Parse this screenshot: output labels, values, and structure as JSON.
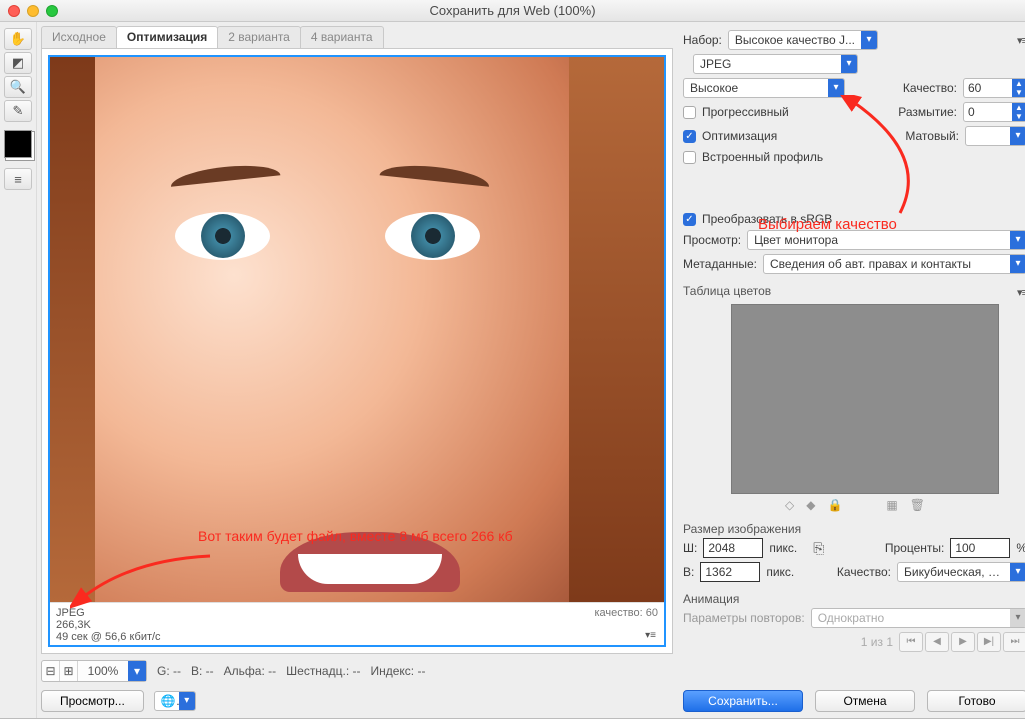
{
  "titlebar": {
    "title": "Сохранить для Web (100%)"
  },
  "tabs": {
    "source": "Исходное",
    "optimize": "Оптимизация",
    "two": "2 варианта",
    "four": "4 варианта"
  },
  "info": {
    "format": "JPEG",
    "size": "266,3K",
    "time": "49 сек @ 56,6 кбит/с",
    "quality_label": "качество: 60"
  },
  "annotation1": "Вот таким будет файл, вместе 8 мб всего 266 кб",
  "annotation2": "Выбираем качество",
  "under": {
    "zoom": "100%",
    "G": "G: --",
    "B": "B: --",
    "alpha": "Альфа: --",
    "hex": "Шестнадц.: --",
    "index": "Индекс: --",
    "preview_btn": "Просмотр..."
  },
  "right": {
    "preset_lbl": "Набор:",
    "preset_val": "Высокое качество J...",
    "format": "JPEG",
    "quality_preset": "Высокое",
    "qual_lbl": "Качество:",
    "qual_val": "60",
    "blur_lbl": "Размытие:",
    "blur_val": "0",
    "matte_lbl": "Матовый:",
    "chk_progressive": "Прогрессивный",
    "chk_optimize": "Оптимизация",
    "chk_profile": "Встроенный профиль",
    "chk_srgb": "Преобразовать в sRGB",
    "viewer_lbl": "Просмотр:",
    "viewer_val": "Цвет монитора",
    "meta_lbl": "Метаданные:",
    "meta_val": "Сведения об авт. правах и контакты",
    "ct_title": "Таблица цветов",
    "size_title": "Размер изображения",
    "w_lbl": "Ш:",
    "w_val": "2048",
    "h_lbl": "В:",
    "h_val": "1362",
    "px": "пикс.",
    "pct_lbl": "Проценты:",
    "pct_val": "100",
    "pct_sign": "%",
    "resample_lbl": "Качество:",
    "resample_val": "Бикубическая, ч...",
    "anim_title": "Анимация",
    "loop_lbl": "Параметры повторов:",
    "loop_val": "Однократно",
    "frame": "1 из 1"
  },
  "buttons": {
    "save": "Сохранить...",
    "cancel": "Отмена",
    "done": "Готово"
  }
}
